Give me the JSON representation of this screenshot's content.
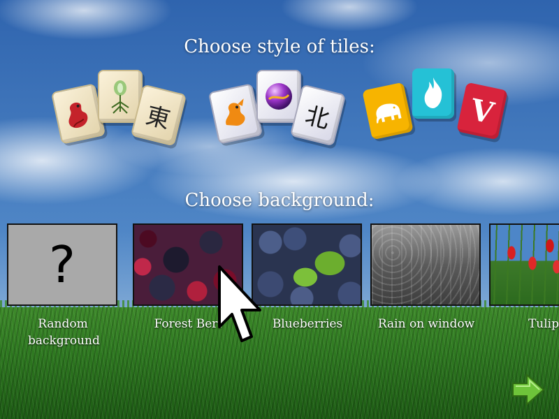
{
  "headings": {
    "tiles": "Choose style of tiles:",
    "background": "Choose background:"
  },
  "tile_styles": [
    {
      "id": "classic",
      "glyphs": [
        "dragon-icon",
        "flower-icon",
        "東"
      ]
    },
    {
      "id": "modern",
      "glyphs": [
        "dragon-icon",
        "orb-icon",
        "北"
      ]
    },
    {
      "id": "colorful",
      "glyphs": [
        "elephant-icon",
        "fire-icon",
        "V"
      ]
    }
  ],
  "backgrounds": [
    {
      "id": "random",
      "label": "Random background",
      "thumb_text": "?"
    },
    {
      "id": "forest",
      "label": "Forest Berr"
    },
    {
      "id": "blueberries",
      "label": "Blueberries"
    },
    {
      "id": "rain",
      "label": "Rain on window"
    },
    {
      "id": "tulips",
      "label": "Tulip"
    }
  ],
  "colors": {
    "classic_tile": "#f3e8c8",
    "modern_tile": "#eeeef6",
    "colorful_yellow": "#f7b400",
    "colorful_cyan": "#25c1d6",
    "colorful_red": "#d8233c",
    "next_arrow": "#6ec43a"
  },
  "icons": {
    "next": "right-arrow-icon",
    "cursor": "mouse-pointer-icon"
  }
}
